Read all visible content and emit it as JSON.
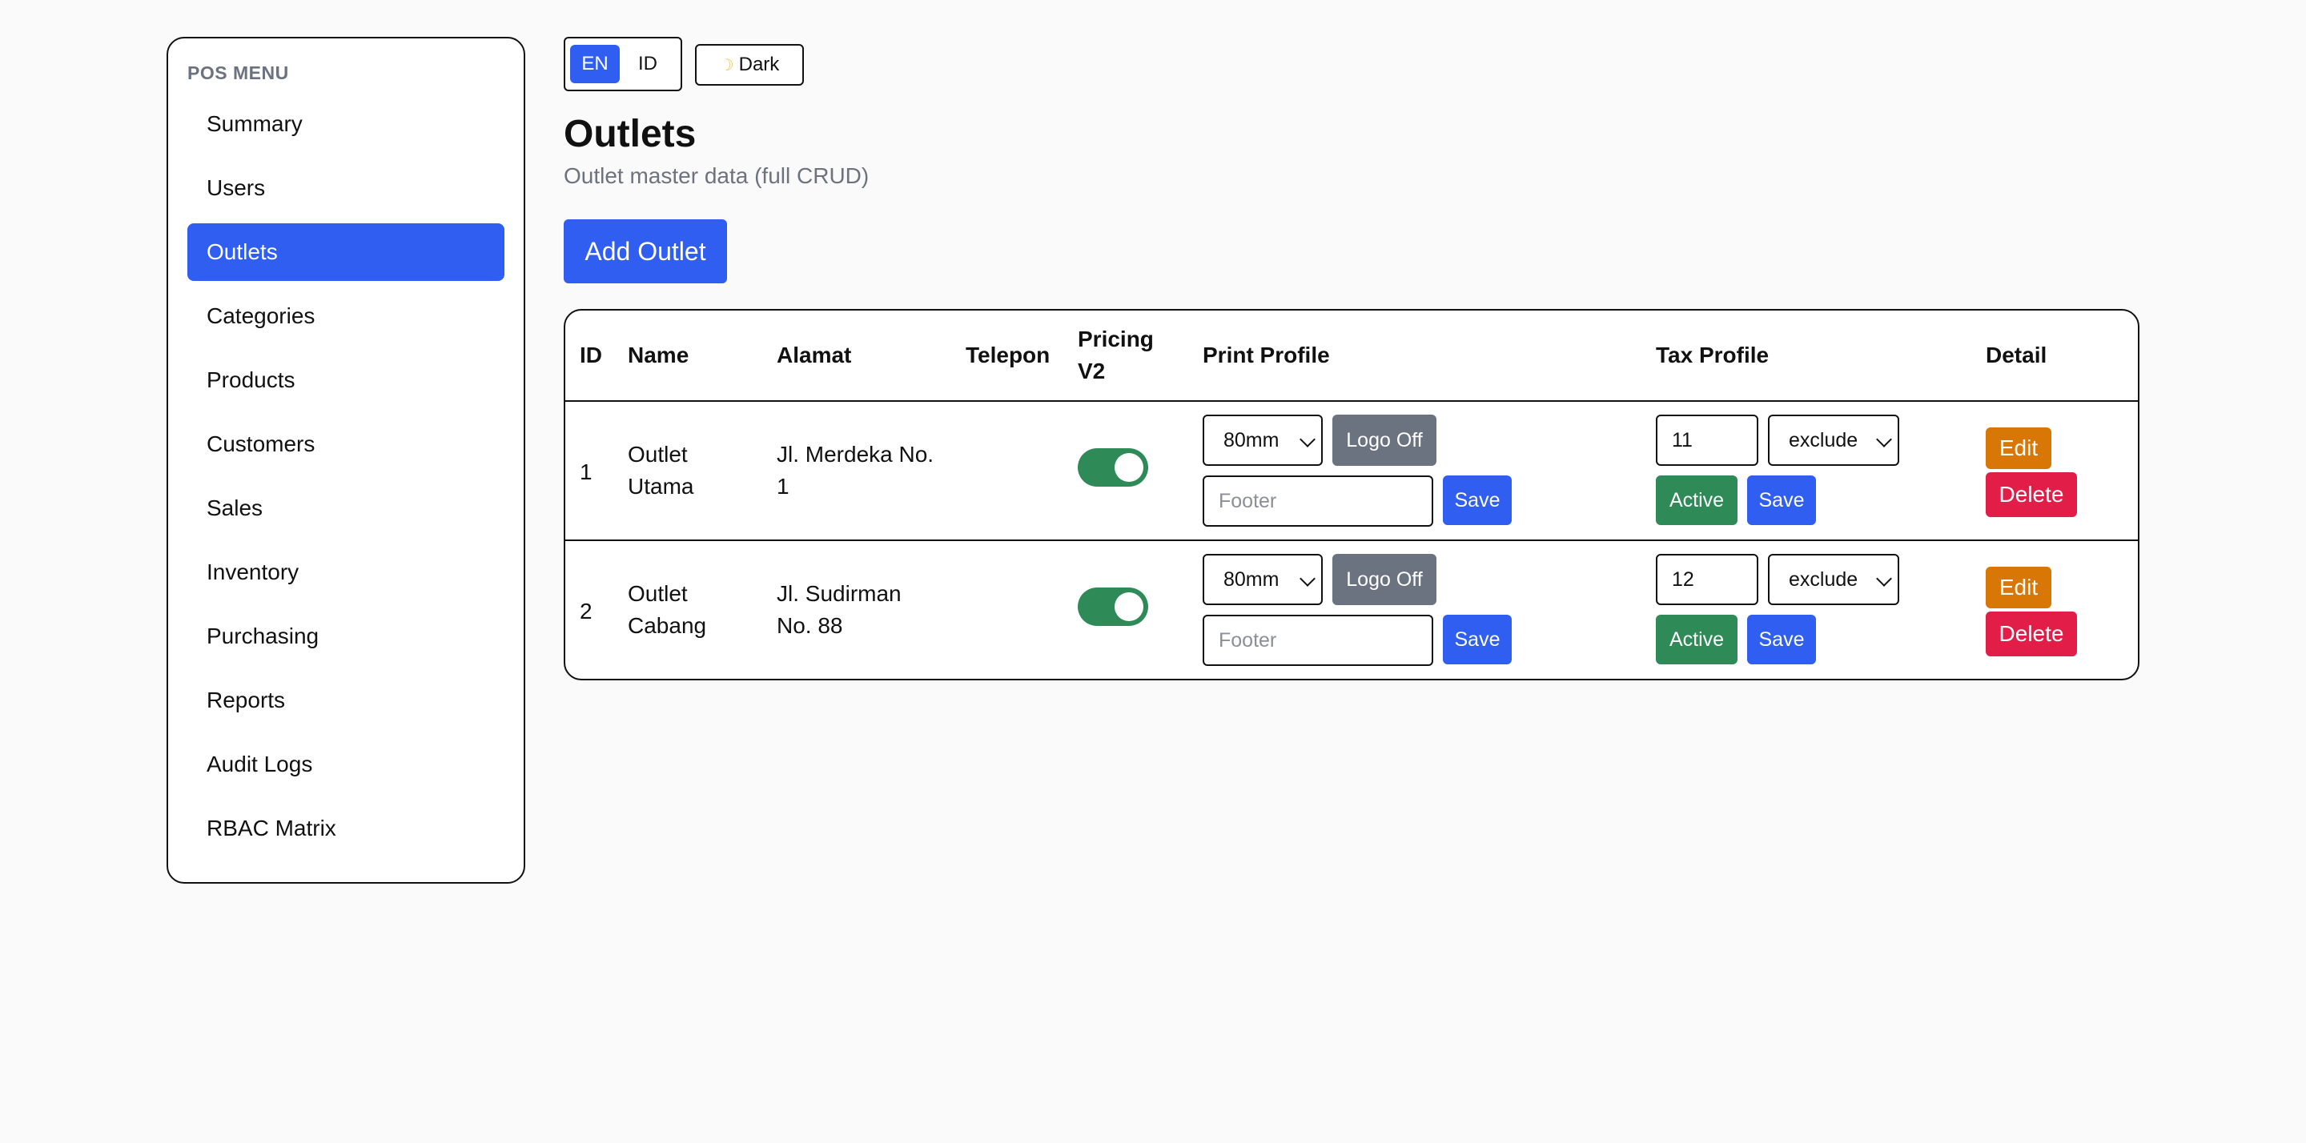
{
  "sidebar": {
    "title": "POS MENU",
    "items": [
      {
        "label": "Summary"
      },
      {
        "label": "Users"
      },
      {
        "label": "Outlets"
      },
      {
        "label": "Categories"
      },
      {
        "label": "Products"
      },
      {
        "label": "Customers"
      },
      {
        "label": "Sales"
      },
      {
        "label": "Inventory"
      },
      {
        "label": "Purchasing"
      },
      {
        "label": "Reports"
      },
      {
        "label": "Audit Logs"
      },
      {
        "label": "RBAC Matrix"
      }
    ],
    "active_item": "Outlets"
  },
  "top": {
    "lang_en": "EN",
    "lang_id": "ID",
    "active_lang": "EN",
    "theme_icon": "moon-icon",
    "theme_label": "Dark"
  },
  "page": {
    "title": "Outlets",
    "subtitle": "Outlet master data (full CRUD)",
    "add_button": "Add Outlet"
  },
  "table": {
    "headers": {
      "id": "ID",
      "name": "Name",
      "alamat": "Alamat",
      "telepon": "Telepon",
      "pricing_line1": "Pricing",
      "pricing_line2": "V2",
      "print_profile": "Print Profile",
      "tax_profile": "Tax Profile",
      "detail": "Detail"
    },
    "rows": [
      {
        "id": "1",
        "name_line1": "Outlet",
        "name_line2": "Utama",
        "alamat_line1": "Jl. Merdeka No.",
        "alamat_line2": "1",
        "telepon": "",
        "pricing_v2": true,
        "paper_size": "80mm",
        "logo_button": "Logo Off",
        "footer_placeholder": "Footer",
        "footer_value": "",
        "print_save": "Save",
        "tax_rate": "11",
        "tax_mode": "exclude",
        "tax_status": "Active",
        "tax_save": "Save",
        "edit": "Edit",
        "delete": "Delete"
      },
      {
        "id": "2",
        "name_line1": "Outlet",
        "name_line2": "Cabang",
        "alamat_line1": "Jl. Sudirman",
        "alamat_line2": "No. 88",
        "telepon": "",
        "pricing_v2": true,
        "paper_size": "80mm",
        "logo_button": "Logo Off",
        "footer_placeholder": "Footer",
        "footer_value": "",
        "print_save": "Save",
        "tax_rate": "12",
        "tax_mode": "exclude",
        "tax_status": "Active",
        "tax_save": "Save",
        "edit": "Edit",
        "delete": "Delete"
      }
    ]
  },
  "colors": {
    "primary": "#2f5ef0",
    "success": "#2e8b57",
    "warning": "#d97706",
    "danger": "#e11d48",
    "muted": "#6b7280"
  }
}
